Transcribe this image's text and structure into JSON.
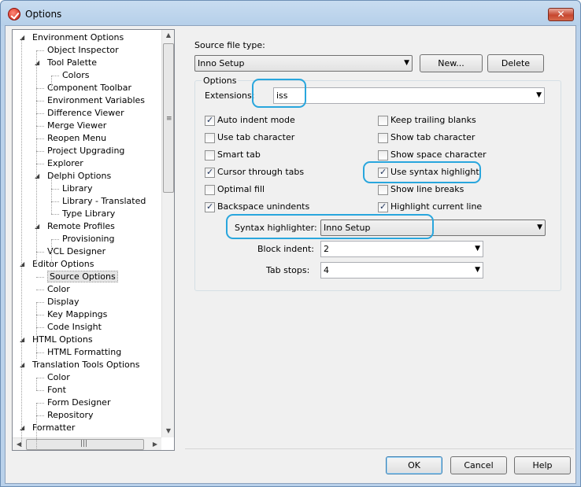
{
  "window": {
    "title": "Options",
    "close_label": "✕"
  },
  "tree": {
    "items": [
      {
        "label": "Environment Options",
        "depth": 0,
        "expanded": true
      },
      {
        "label": "Object Inspector",
        "depth": 1
      },
      {
        "label": "Tool Palette",
        "depth": 1,
        "expanded": true
      },
      {
        "label": "Colors",
        "depth": 2
      },
      {
        "label": "Component Toolbar",
        "depth": 1
      },
      {
        "label": "Environment Variables",
        "depth": 1
      },
      {
        "label": "Difference Viewer",
        "depth": 1
      },
      {
        "label": "Merge Viewer",
        "depth": 1
      },
      {
        "label": "Reopen Menu",
        "depth": 1
      },
      {
        "label": "Project Upgrading",
        "depth": 1
      },
      {
        "label": "Explorer",
        "depth": 1
      },
      {
        "label": "Delphi Options",
        "depth": 1,
        "expanded": true
      },
      {
        "label": "Library",
        "depth": 2
      },
      {
        "label": "Library - Translated",
        "depth": 2
      },
      {
        "label": "Type Library",
        "depth": 2
      },
      {
        "label": "Remote Profiles",
        "depth": 1,
        "expanded": true
      },
      {
        "label": "Provisioning",
        "depth": 2
      },
      {
        "label": "VCL Designer",
        "depth": 1
      },
      {
        "label": "Editor Options",
        "depth": 0,
        "expanded": true
      },
      {
        "label": "Source Options",
        "depth": 1,
        "selected": true
      },
      {
        "label": "Color",
        "depth": 1
      },
      {
        "label": "Display",
        "depth": 1
      },
      {
        "label": "Key Mappings",
        "depth": 1
      },
      {
        "label": "Code Insight",
        "depth": 1
      },
      {
        "label": "HTML Options",
        "depth": 0,
        "expanded": true
      },
      {
        "label": "HTML Formatting",
        "depth": 1
      },
      {
        "label": "Translation Tools Options",
        "depth": 0,
        "expanded": true
      },
      {
        "label": "Color",
        "depth": 1
      },
      {
        "label": "Font",
        "depth": 1
      },
      {
        "label": "Form Designer",
        "depth": 1
      },
      {
        "label": "Repository",
        "depth": 1
      },
      {
        "label": "Formatter",
        "depth": 0,
        "expanded": true
      }
    ]
  },
  "source": {
    "file_type_label": "Source file type:",
    "file_type_value": "Inno Setup",
    "new_button": "New...",
    "delete_button": "Delete"
  },
  "options": {
    "group_caption": "Options",
    "extensions_label": "Extensions:",
    "extensions_value": "iss",
    "checkboxes_left": [
      {
        "label": "Auto indent mode",
        "checked": true
      },
      {
        "label": "Use tab character",
        "checked": false
      },
      {
        "label": "Smart tab",
        "checked": false
      },
      {
        "label": "Cursor through tabs",
        "checked": true
      },
      {
        "label": "Optimal fill",
        "checked": false
      },
      {
        "label": "Backspace unindents",
        "checked": true
      }
    ],
    "checkboxes_right": [
      {
        "label": "Keep trailing blanks",
        "checked": false
      },
      {
        "label": "Show tab character",
        "checked": false
      },
      {
        "label": "Show space character",
        "checked": false
      },
      {
        "label": "Use syntax highlight",
        "checked": true
      },
      {
        "label": "Show line breaks",
        "checked": false
      },
      {
        "label": "Highlight current line",
        "checked": true
      }
    ],
    "syntax_label": "Syntax highlighter:",
    "syntax_value": "Inno Setup",
    "block_indent_label": "Block indent:",
    "block_indent_value": "2",
    "tab_stops_label": "Tab stops:",
    "tab_stops_value": "4"
  },
  "footer": {
    "ok": "OK",
    "cancel": "Cancel",
    "help": "Help"
  },
  "colors": {
    "annotation": "#29a6dd",
    "titlebar": "#b9d1ea"
  }
}
